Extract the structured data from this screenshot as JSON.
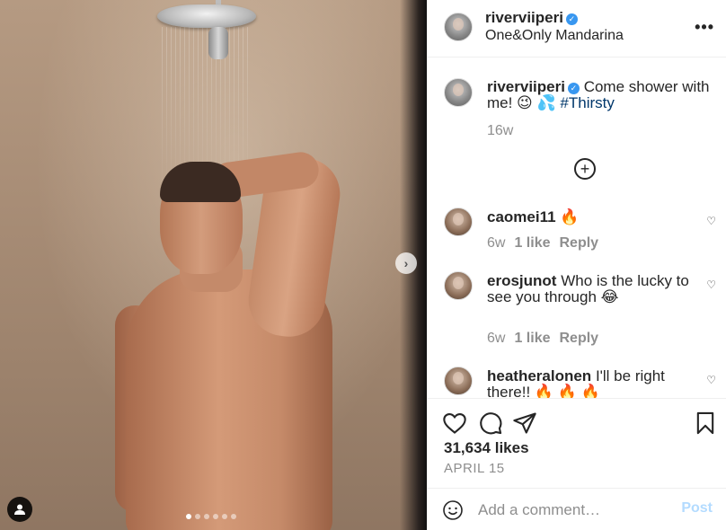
{
  "post": {
    "username": "riverviiperi",
    "location": "One&Only Mandarina",
    "caption_text": "Come shower with me! 😉 💦",
    "caption_hashtag": "#Thirsty",
    "caption_time": "16w",
    "likes": "31,634 likes",
    "date": "APRIL 15"
  },
  "header": {
    "more_label": "•••"
  },
  "comments": [
    {
      "username": "caomei11",
      "text": "🔥",
      "time": "6w",
      "likes": "1 like",
      "reply": "Reply"
    },
    {
      "username": "erosjunot",
      "text": "Who is the lucky to see you through 😂",
      "time": "6w",
      "likes": "1 like",
      "reply": "Reply"
    },
    {
      "username": "heatheralonen",
      "text": "I'll be right there!! 🔥 🔥 🔥",
      "time": "",
      "likes": "",
      "reply": ""
    }
  ],
  "carousel": {
    "count": 6,
    "active": 0
  },
  "add_comment": {
    "placeholder": "Add a comment…",
    "post_label": "Post"
  },
  "icons": [
    "heart-icon",
    "comment-icon",
    "share-icon",
    "bookmark-icon",
    "emoji-icon",
    "user-tag-icon",
    "chevron-right-icon",
    "plus-circle-icon",
    "verified-icon"
  ],
  "colors": {
    "link": "#00376b",
    "verified": "#3897f0",
    "post_disabled": "#b3dbff",
    "muted": "#8e8e8e"
  }
}
